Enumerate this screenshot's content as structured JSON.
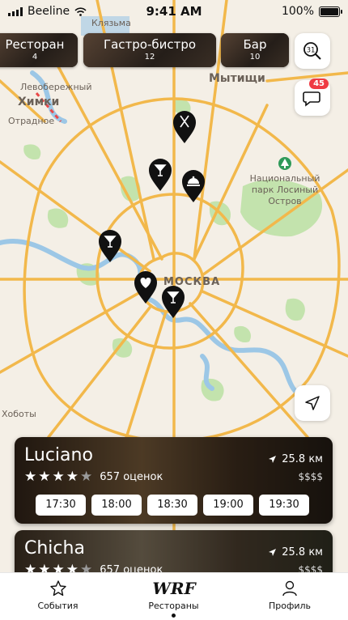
{
  "status": {
    "carrier": "Beeline",
    "time": "9:41 AM",
    "battery": "100%"
  },
  "categories": [
    {
      "label": "Ресторан",
      "count": "4"
    },
    {
      "label": "Гастро-бистро",
      "count": "12"
    },
    {
      "label": "Бар",
      "count": "10"
    }
  ],
  "calendar_day": "31",
  "chat_badge": "45",
  "map_labels": {
    "khimki": "Химки",
    "mytishchi": "Мытищи",
    "moscow": "МОСКВА",
    "park_line1": "Национальный",
    "park_line2": "парк Лосиный",
    "park_line3": "Остров",
    "klyazma": "Клязьма",
    "levoberezhny": "Левобережный",
    "otradnoe": "Отрадное",
    "khoboty": "Хоботы"
  },
  "restaurants": [
    {
      "name": "Luciano",
      "rating": 4,
      "reviews": "657 оценок",
      "distance": "25.8 км",
      "price": "$$$$",
      "times": [
        "17:30",
        "18:00",
        "18:30",
        "19:00",
        "19:30"
      ]
    },
    {
      "name": "Chicha",
      "rating": 4,
      "reviews": "657 оценок",
      "distance": "25.8 км",
      "price": "$$$$",
      "times": []
    }
  ],
  "tabs": [
    {
      "label": "События",
      "icon": "star-icon"
    },
    {
      "label": "Рестораны",
      "icon": "wrf-logo",
      "logo_text": "WRF"
    },
    {
      "label": "Профиль",
      "icon": "person-icon"
    }
  ],
  "colors": {
    "accent": "#ef3a43",
    "road": "#f2b84b",
    "water": "#9cc7e6",
    "park": "#c3e3ad",
    "pin": "#111111"
  }
}
